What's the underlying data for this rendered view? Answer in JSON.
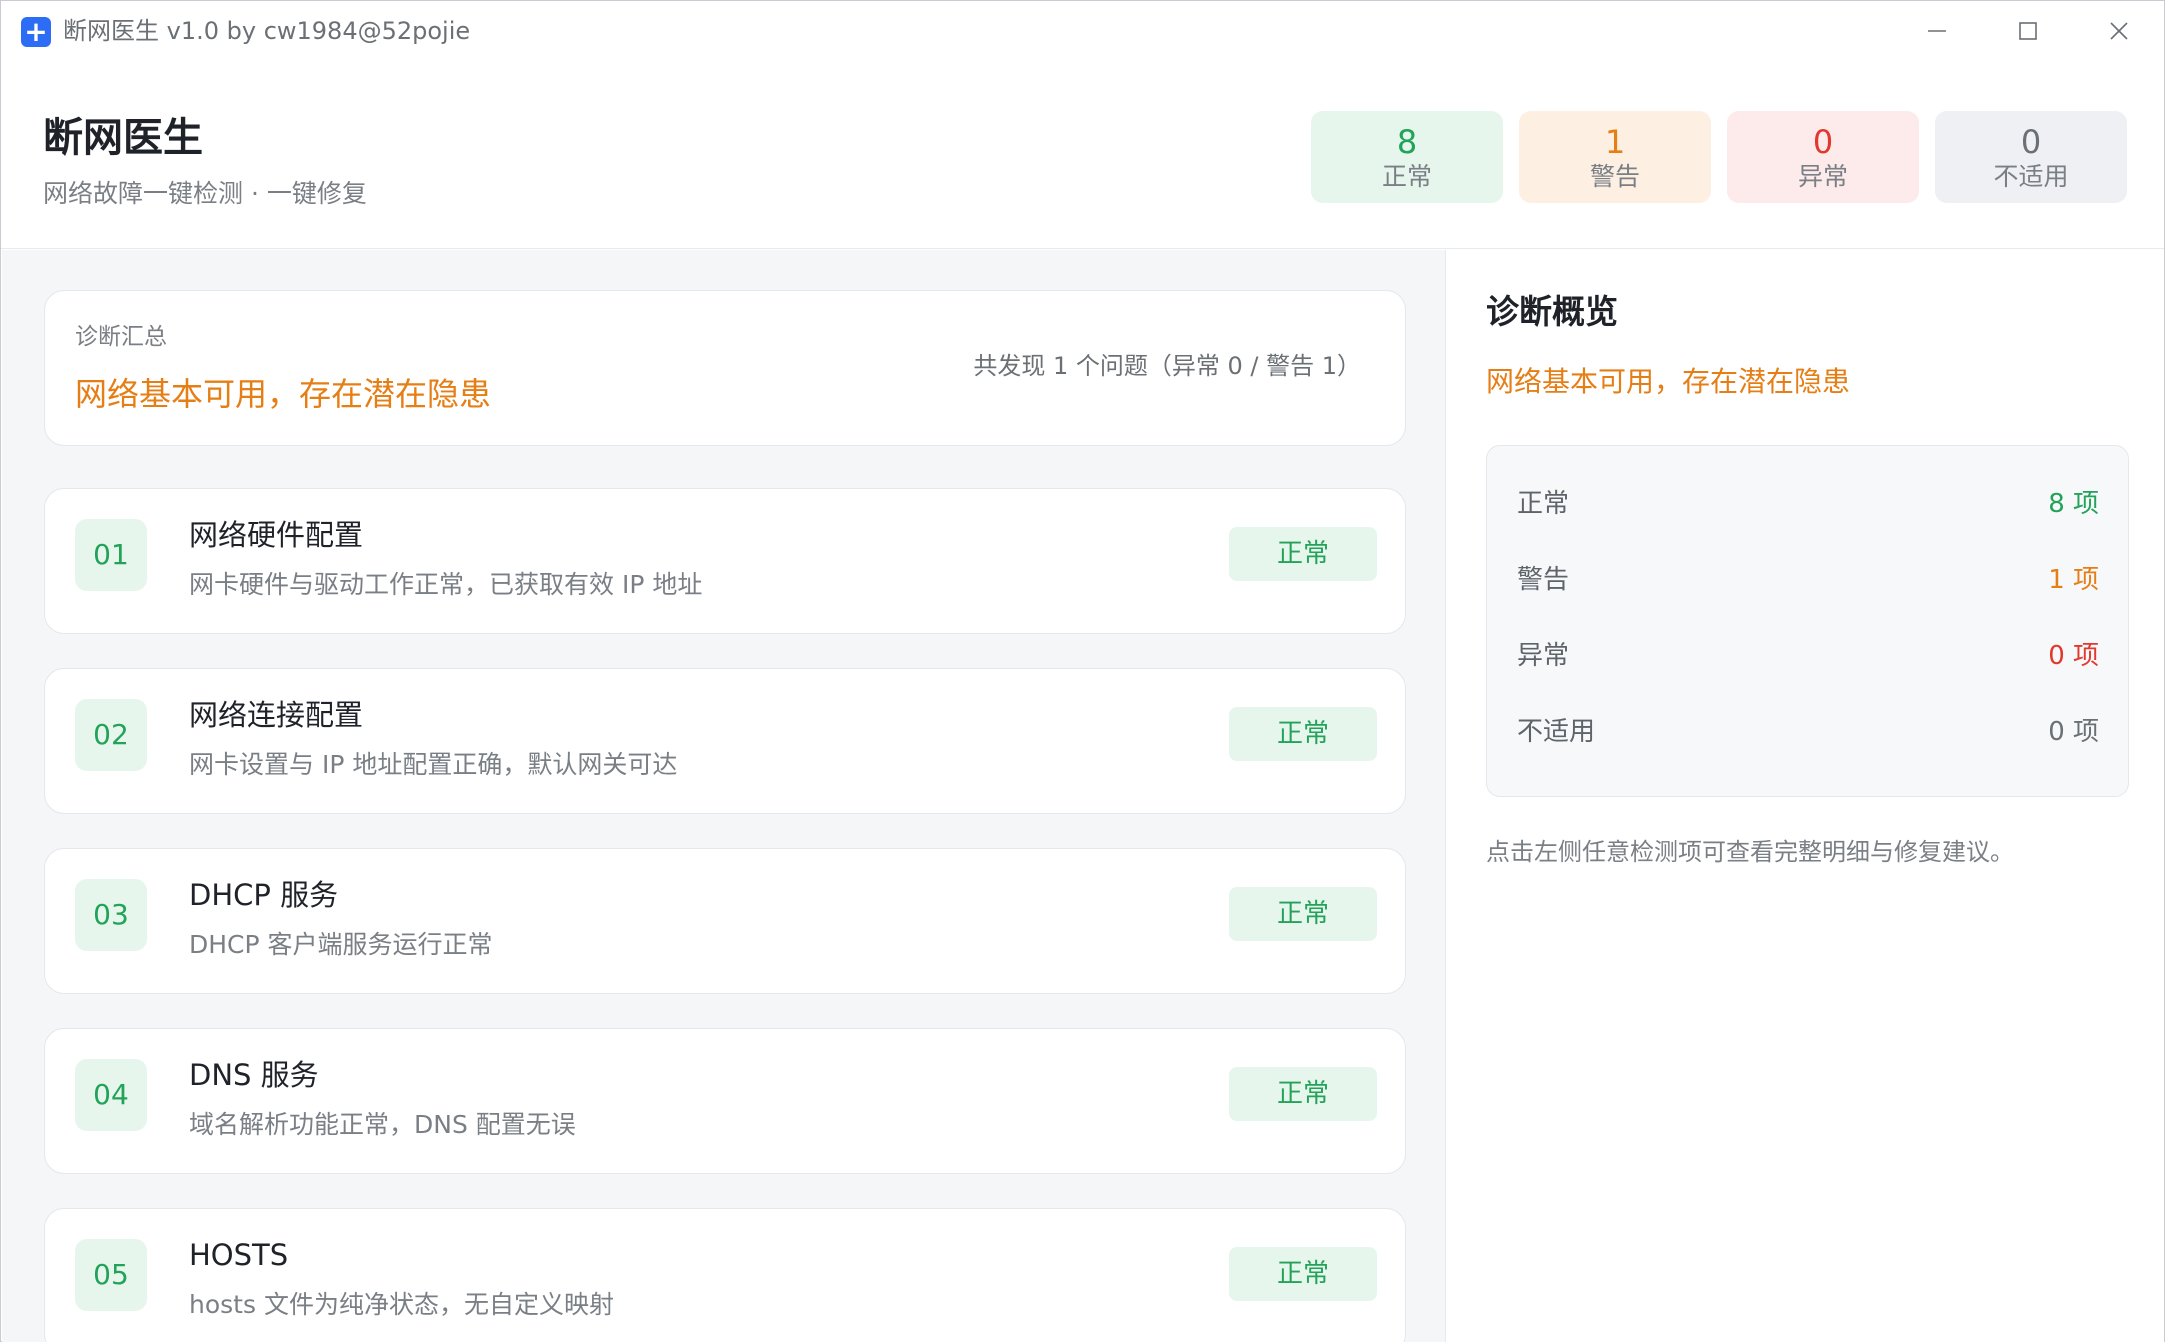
{
  "window": {
    "title": "断网医生 v1.0 by cw1984@52pojie"
  },
  "header": {
    "app_name": "断网医生",
    "subtitle": "网络故障一键检测 · 一键修复",
    "stats": [
      {
        "value": "8",
        "label": "正常"
      },
      {
        "value": "1",
        "label": "警告"
      },
      {
        "value": "0",
        "label": "异常"
      },
      {
        "value": "0",
        "label": "不适用"
      }
    ]
  },
  "summary": {
    "label": "诊断汇总",
    "status_text": "网络基本可用，存在潜在隐患",
    "count_text": "共发现 1 个问题（异常 0 / 警告 1）"
  },
  "items": [
    {
      "num": "01",
      "title": "网络硬件配置",
      "desc": "网卡硬件与驱动工作正常，已获取有效 IP 地址",
      "status": "正常"
    },
    {
      "num": "02",
      "title": "网络连接配置",
      "desc": "网卡设置与 IP 地址配置正确，默认网关可达",
      "status": "正常"
    },
    {
      "num": "03",
      "title": "DHCP 服务",
      "desc": "DHCP 客户端服务运行正常",
      "status": "正常"
    },
    {
      "num": "04",
      "title": "DNS 服务",
      "desc": "域名解析功能正常，DNS 配置无误",
      "status": "正常"
    },
    {
      "num": "05",
      "title": "HOSTS",
      "desc": "hosts 文件为纯净状态，无自定义映射",
      "status": "正常"
    }
  ],
  "overview": {
    "title": "诊断概览",
    "status_text": "网络基本可用，存在潜在隐患",
    "rows": [
      {
        "label": "正常",
        "value": "8 项"
      },
      {
        "label": "警告",
        "value": "1 项"
      },
      {
        "label": "异常",
        "value": "0 项"
      },
      {
        "label": "不适用",
        "value": "0 项"
      }
    ],
    "hint": "点击左侧任意检测项可查看完整明细与修复建议。"
  },
  "colors": {
    "normal": "#23a35a",
    "warning": "#e67e16",
    "error": "#e2382e",
    "accent": "#2d6df6"
  },
  "icons": {
    "app": "plus-icon",
    "minimize": "minimize-icon",
    "maximize": "maximize-icon",
    "close": "close-icon"
  }
}
